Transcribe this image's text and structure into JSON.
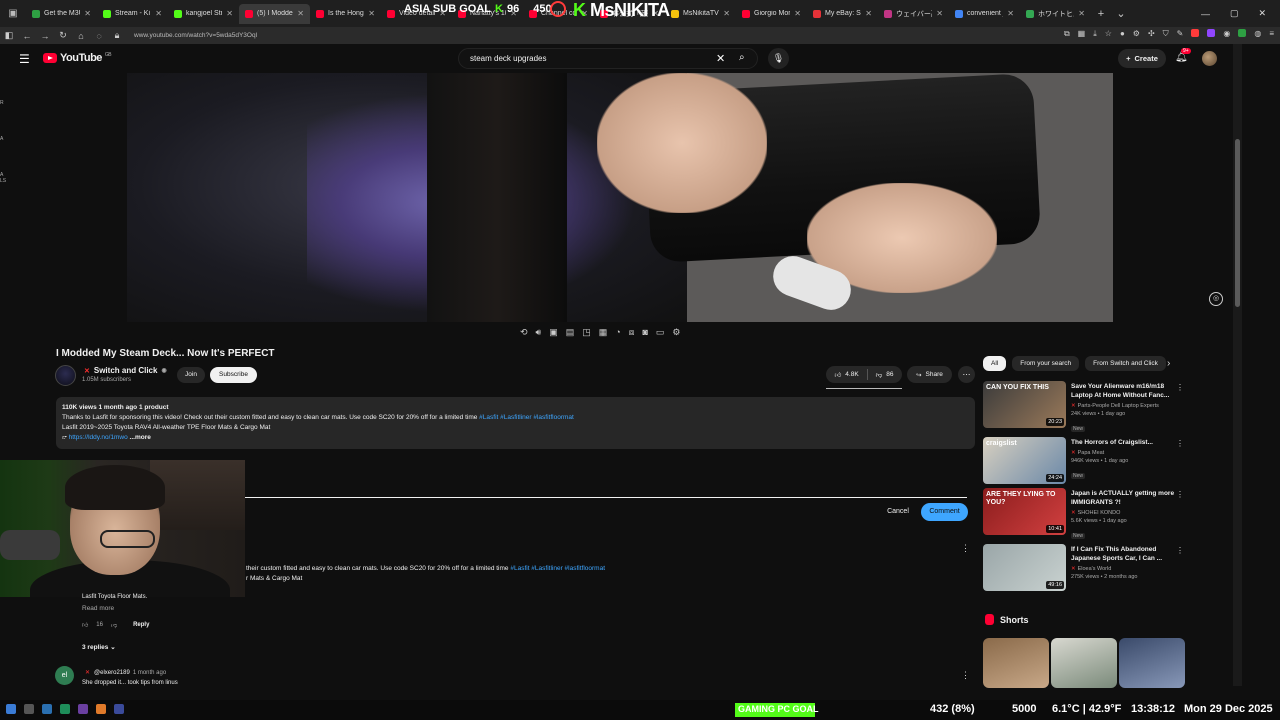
{
  "browser": {
    "tabs": [
      {
        "title": "Get the M3U8 f",
        "color": "#2ea043"
      },
      {
        "title": "Stream - Ki",
        "color": "#53fc18"
      },
      {
        "title": "kangjoel Stream",
        "color": "#53fc18"
      },
      {
        "title": "(5) I Modded M",
        "color": "#ff0033"
      },
      {
        "title": "Is the Hong Kon",
        "color": "#ff0033"
      },
      {
        "title": "Video details - Y",
        "color": "#ff0033"
      },
      {
        "title": "Nanatty's 100 D",
        "color": "#ff0033"
      },
      {
        "title": "Channel conten",
        "color": "#ff0033"
      },
      {
        "title": "非公式「蓮蓮な",
        "color": "#ff0033"
      },
      {
        "title": "MsNikitaTV - Fi",
        "color": "#f4c20d"
      },
      {
        "title": "Giorgio Moroda",
        "color": "#ff0033"
      },
      {
        "title": "My eBay: Selling",
        "color": "#e53238"
      },
      {
        "title": "ウェイバー高杉",
        "color": "#c13584"
      },
      {
        "title": "convenient jelo",
        "color": "#4285f4"
      },
      {
        "title": "ホワイトヒルズ",
        "color": "#34a853"
      }
    ],
    "url": "www.youtube.com/watch?v=5wda5dY3Oql"
  },
  "youtube": {
    "logo_text": "YouTube",
    "country_code": "GB",
    "search_value": "steam deck upgrades",
    "create_label": "Create",
    "notif_count": "9+"
  },
  "video": {
    "title": "I Modded My Steam Deck... Now It's PERFECT",
    "channel": "Switch and Click",
    "subscribers": "1.05M subscribers",
    "join_label": "Join",
    "subscribe_label": "Subscribe",
    "likes": "4.8K",
    "dislikes": "86",
    "share_label": "Share"
  },
  "description": {
    "meta": "110K views  1 month ago  1 product",
    "line1": "Thanks to Lasfit for sponsoring this video! Check out their custom fitted and easy to clean car mats. Use code SC20 for 20% off for a limited time ",
    "tags": "#Lasfit #Lasfitliner #lasfitfloormat",
    "line2": "Lasfit 2019~2025 Toyota RAV4 All-weather TPE Floor Mats & Cargo Mat",
    "link": "https://lddy.no/1mwo",
    "more": "...more"
  },
  "comments": {
    "cancel_label": "Cancel",
    "comment_label": "Comment",
    "pinned_line1": "their custom fitted and easy to clean car mats. Use code SC20 for 20% off for a limited time ",
    "pinned_tags": "#Lasfit #Lasfitliner #lasfitfloormat",
    "pinned_line2": "r Mats & Cargo Mat",
    "lasfit_line": "Lasfit Toyota Floor Mats.",
    "read_more": "Read more",
    "like_count": "16",
    "reply_label": "Reply",
    "replies_label": "3 replies",
    "c2_avatar": "el",
    "c2_user": "@elxero2189",
    "c2_when": "1 month ago",
    "c2_text": "She dropped it... took tips from linus"
  },
  "chips": [
    "All",
    "From your search",
    "From Switch and Click"
  ],
  "recommendations": [
    {
      "title": "Save Your Alienware m16/m18 Laptop At Home Without Fanc...",
      "channel": "Parts-People Dell Laptop Experts",
      "stats": "24K views • 1 day ago",
      "badge": "New",
      "duration": "20:23",
      "colors": [
        "#3b3b3b",
        "#9b7a5a"
      ],
      "thumb_text": "CAN YOU FIX THIS"
    },
    {
      "title": "The Horrors of Craigslist...",
      "channel": "Papa Meat",
      "stats": "946K views • 1 day ago",
      "badge": "New",
      "duration": "24:24",
      "colors": [
        "#d8d0c0",
        "#6a88a8"
      ],
      "thumb_text": "craigslist"
    },
    {
      "title": "Japan is ACTUALLY getting more IMMIGRANTS ?!",
      "channel": "SHOHEI KONDO",
      "stats": "5.6K views • 1 day ago",
      "badge": "New",
      "duration": "10:41",
      "colors": [
        "#8b1d1d",
        "#d24040"
      ],
      "thumb_text": "ARE THEY LYING TO YOU?"
    },
    {
      "title": "If I Can Fix This Abandoned Japanese Sports Car, I Can ...",
      "channel": "Eloea's World",
      "stats": "275K views • 2 months ago",
      "badge": "",
      "duration": "49:16",
      "colors": [
        "#9aa6a8",
        "#c9d2d0"
      ],
      "thumb_text": ""
    }
  ],
  "shorts": {
    "heading": "Shorts",
    "thumbs": [
      [
        "#8a6a4a",
        "#c8a888"
      ],
      [
        "#d8d8d0",
        "#7a8a7a"
      ],
      [
        "#3a4a6a",
        "#8898b8"
      ]
    ]
  },
  "stream_overlay": {
    "goal_label": "ASIA SUB GOAL",
    "goal_current": "96",
    "goal_target": "450",
    "brand": "MsNIKITA",
    "brand_k": "K",
    "gpc_label": "GAMING PC GOAL",
    "gpc_current": "432 (8%)",
    "gpc_target": "5000",
    "weather": "6.1°C | 42.9°F",
    "time": "13:38:12",
    "date": "Mon 29 Dec 2025"
  }
}
